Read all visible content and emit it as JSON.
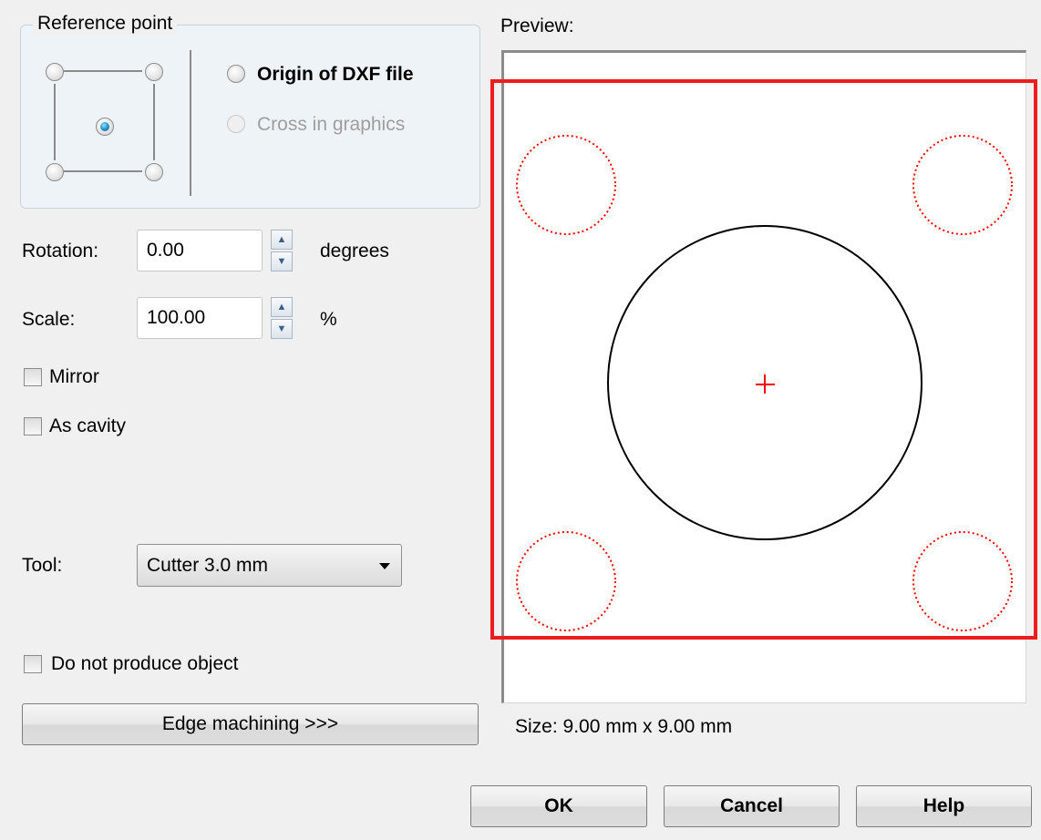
{
  "reference_point": {
    "title": "Reference point",
    "selected_position": "center",
    "origin_label": "Origin of DXF file",
    "cross_label": "Cross in graphics"
  },
  "rotation": {
    "label": "Rotation:",
    "value": "0.00",
    "unit": "degrees"
  },
  "scale": {
    "label": "Scale:",
    "value": "100.00",
    "unit": "%"
  },
  "mirror": {
    "label": "Mirror",
    "checked": false
  },
  "as_cavity": {
    "label": "As cavity",
    "checked": false
  },
  "tool": {
    "label": "Tool:",
    "value": "Cutter 3.0 mm"
  },
  "do_not_produce": {
    "label": "Do not produce object",
    "checked": false
  },
  "edge_machining": {
    "label": "Edge machining >>>"
  },
  "preview": {
    "title": "Preview:",
    "size_text": "Size: 9.00 mm x 9.00 mm",
    "shape_color": "#000000",
    "marker_color": "#ff0000",
    "highlight_color": "#ee1c1c"
  },
  "buttons": {
    "ok": "OK",
    "cancel": "Cancel",
    "help": "Help"
  }
}
